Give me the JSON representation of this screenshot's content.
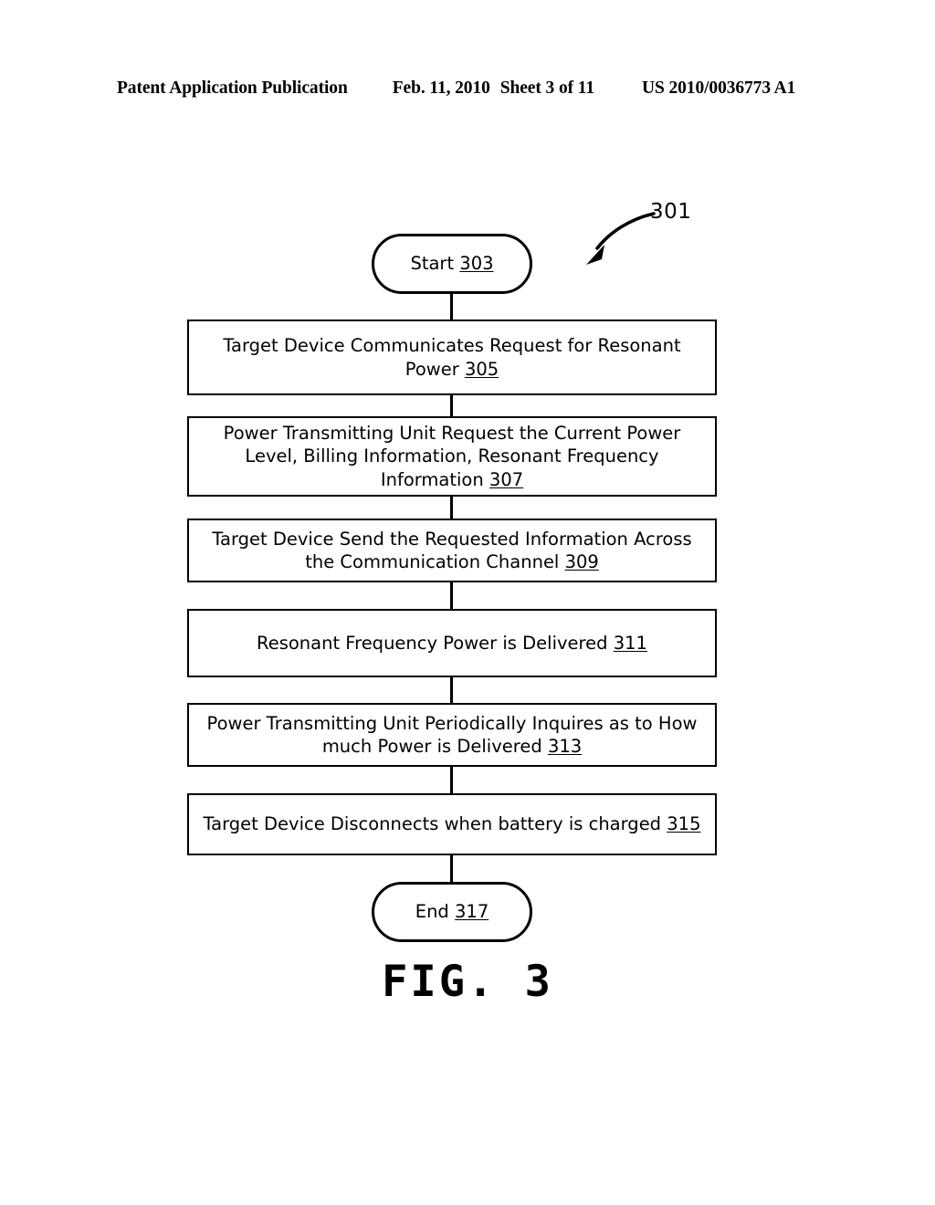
{
  "header": {
    "publication": "Patent Application Publication",
    "date": "Feb. 11, 2010",
    "sheet": "Sheet 3 of 11",
    "patent_number": "US 2010/0036773 A1"
  },
  "figure": {
    "caption": "FIG. 3",
    "reference_numeral": "301",
    "lead_arrow": "curved-arrow-icon",
    "nodes": [
      {
        "id": "start",
        "shape": "terminal",
        "text": "Start ",
        "numeral": "303"
      },
      {
        "id": "step-305",
        "shape": "process",
        "text": "Target Device Communicates Request for Resonant Power ",
        "numeral": "305"
      },
      {
        "id": "step-307",
        "shape": "process",
        "text": "Power Transmitting Unit Request the Current Power Level, Billing Information, Resonant Frequency Information ",
        "numeral": "307"
      },
      {
        "id": "step-309",
        "shape": "process",
        "text": "Target Device Send the Requested Information Across the Communication Channel ",
        "numeral": "309"
      },
      {
        "id": "step-311",
        "shape": "process",
        "text": "Resonant Frequency Power is Delivered ",
        "numeral": "311"
      },
      {
        "id": "step-313",
        "shape": "process",
        "text": "Power Transmitting Unit Periodically Inquires as to How much Power is Delivered ",
        "numeral": "313"
      },
      {
        "id": "step-315",
        "shape": "process",
        "text": "Target Device Disconnects when battery is charged ",
        "numeral": "315"
      },
      {
        "id": "end",
        "shape": "terminal",
        "text": "End ",
        "numeral": "317"
      }
    ]
  },
  "colors": {
    "ink": "#000000",
    "paper": "#ffffff"
  }
}
